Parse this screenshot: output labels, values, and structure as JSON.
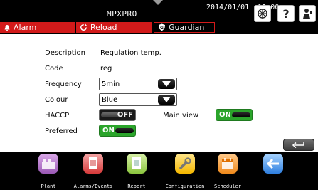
{
  "header": {
    "app_title": "MPXPRO",
    "datetime": "2014/01/01  12:00",
    "icons": [
      "system-icon",
      "help-icon",
      "user-icon"
    ]
  },
  "tabs": {
    "alarm": "Alarm",
    "reload": "Reload",
    "guardian": "Guardian"
  },
  "form": {
    "description": {
      "label": "Description",
      "value": "Regulation temp."
    },
    "code": {
      "label": "Code",
      "value": "reg"
    },
    "frequency": {
      "label": "Frequency",
      "value": "5min"
    },
    "colour": {
      "label": "Colour",
      "value": "Blue"
    },
    "haccp": {
      "label": "HACCP",
      "state": "OFF"
    },
    "main_view": {
      "label": "Main view",
      "state": "ON"
    },
    "preferred": {
      "label": "Preferred",
      "state": "ON"
    }
  },
  "nav": {
    "plant": "Plant",
    "alarms_events": "Alarms/Events",
    "report": "Report",
    "configuration": "Configuration",
    "scheduler": "Scheduler",
    "back": ""
  },
  "colors": {
    "alarm_red": "#d21a1a",
    "toggle_on": "#2ba52b",
    "toggle_off": "#1a1a1a",
    "bar_black": "#000000"
  }
}
